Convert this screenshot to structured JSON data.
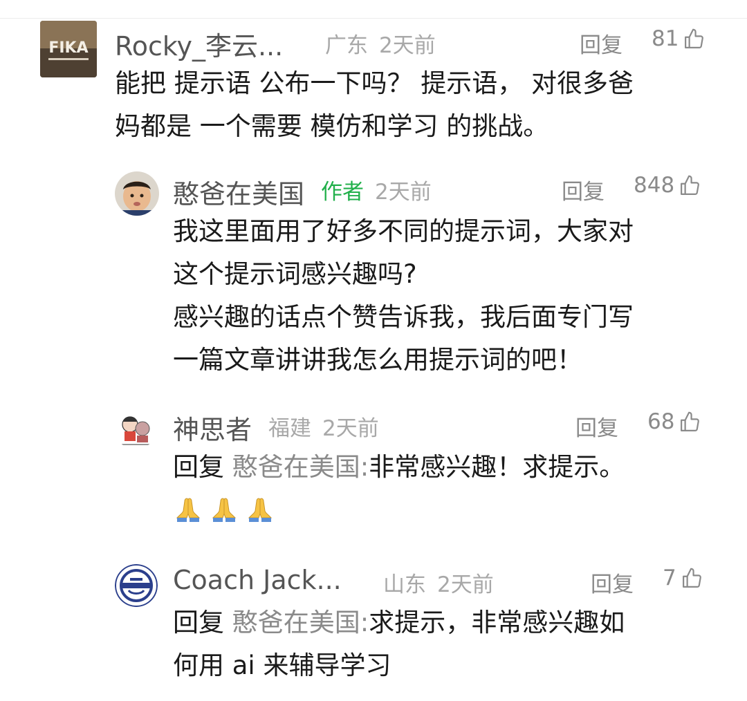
{
  "comments": [
    {
      "name": "Rocky_李云...",
      "location": "广东",
      "time": "2天前",
      "reply_label": "回复",
      "likes": "81",
      "avatar_text": "FIKA",
      "body_lines": [
        "能把 提示语 公布一下吗？  提示语， 对很多爸",
        "妈都是 一个需要 模仿和学习 的挑战。"
      ]
    },
    {
      "name": "憨爸在美国",
      "author_badge": "作者",
      "time": "2天前",
      "reply_label": "回复",
      "likes": "848",
      "body_lines": [
        "我这里面用了好多不同的提示词，大家对",
        "这个提示词感兴趣吗?",
        "感兴趣的话点个赞告诉我，我后面专门写",
        "一篇文章讲讲我怎么用提示词的吧！"
      ]
    },
    {
      "name": "神思者",
      "location": "福建",
      "time": "2天前",
      "reply_label": "回复",
      "likes": "68",
      "reply_prefix": "回复",
      "reply_target": "憨爸在美国:",
      "body_lines": [
        "非常感兴趣！求提示。"
      ],
      "emojis": [
        "🙏",
        "🙏",
        "🙏"
      ]
    },
    {
      "name": "Coach Jack...",
      "location": "山东",
      "time": "2天前",
      "reply_label": "回复",
      "likes": "7",
      "reply_prefix": "回复",
      "reply_target": "憨爸在美国:",
      "body_lines": [
        "求提示，非常感兴趣如",
        "何用 ai 来辅导学习"
      ]
    }
  ],
  "colors": {
    "author_badge": "#22b04b",
    "meta_text": "#a8a8a8",
    "name_text": "#555555",
    "body_text": "#1a1a1a"
  },
  "icons": [
    "thumbs-up-icon",
    "folded-hands-icon"
  ]
}
